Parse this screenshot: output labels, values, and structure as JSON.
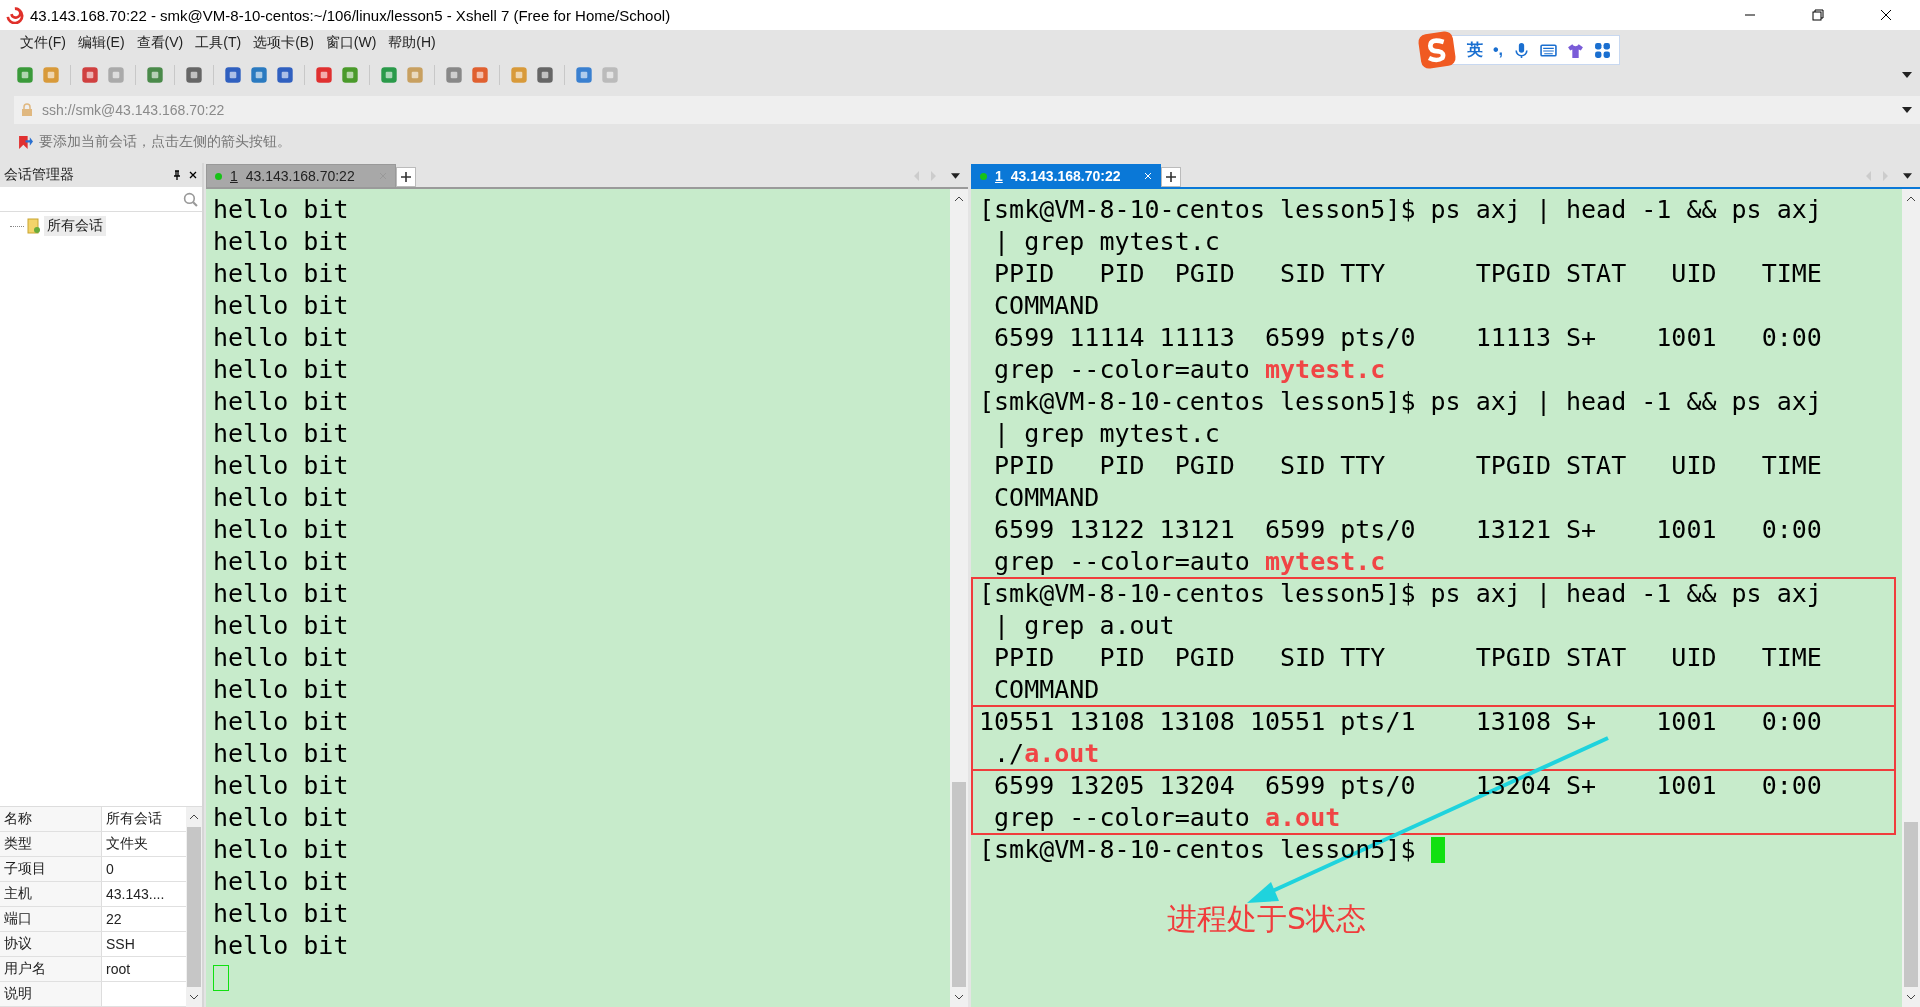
{
  "window": {
    "title": "43.143.168.70:22 - smk@VM-8-10-centos:~/106/linux/lesson5 - Xshell 7 (Free for Home/School)"
  },
  "menu": [
    "文件(F)",
    "编辑(E)",
    "查看(V)",
    "工具(T)",
    "选项卡(B)",
    "窗口(W)",
    "帮助(H)"
  ],
  "ime": {
    "mode": "英",
    "punctuation": "•,"
  },
  "address": {
    "value": "ssh://smk@43.143.168.70:22"
  },
  "hint": "要添加当前会话，点击左侧的箭头按钮。",
  "session_manager": {
    "title": "会话管理器",
    "tree": [
      {
        "label": "所有会话",
        "selected": true
      }
    ],
    "properties": [
      {
        "name": "名称",
        "value": "所有会话"
      },
      {
        "name": "类型",
        "value": "文件夹"
      },
      {
        "name": "子项目",
        "value": "0"
      },
      {
        "name": "主机",
        "value": "43.143...."
      },
      {
        "name": "端口",
        "value": "22"
      },
      {
        "name": "协议",
        "value": "SSH"
      },
      {
        "name": "用户名",
        "value": "root"
      },
      {
        "name": "说明"
      }
    ]
  },
  "panes": [
    {
      "tab": {
        "number": "1",
        "label": "43.143.168.70:22",
        "selected": false
      },
      "lines": [
        {
          "text": "hello bit"
        },
        {
          "text": "hello bit"
        },
        {
          "text": "hello bit"
        },
        {
          "text": "hello bit"
        },
        {
          "text": "hello bit"
        },
        {
          "text": "hello bit"
        },
        {
          "text": "hello bit"
        },
        {
          "text": "hello bit"
        },
        {
          "text": "hello bit"
        },
        {
          "text": "hello bit"
        },
        {
          "text": "hello bit"
        },
        {
          "text": "hello bit"
        },
        {
          "text": "hello bit"
        },
        {
          "text": "hello bit"
        },
        {
          "text": "hello bit"
        },
        {
          "text": "hello bit"
        },
        {
          "text": "hello bit"
        },
        {
          "text": "hello bit"
        },
        {
          "text": "hello bit"
        },
        {
          "text": "hello bit"
        },
        {
          "text": "hello bit"
        },
        {
          "text": "hello bit"
        },
        {
          "text": "hello bit"
        },
        {
          "text": "hello bit"
        },
        {
          "cursor": true
        }
      ]
    },
    {
      "tab": {
        "number": "1",
        "label": "43.143.168.70:22",
        "selected": true
      },
      "lines": [
        {
          "text": "[smk@VM-8-10-centos lesson5]$ ps axj | head -1 && ps axj"
        },
        {
          "text": " | grep mytest.c"
        },
        {
          "text": " PPID   PID  PGID   SID TTY      TPGID STAT   UID   TIME"
        },
        {
          "text": " COMMAND"
        },
        {
          "text": " 6599 11114 11113  6599 pts/0    11113 S+    1001   0:00"
        },
        {
          "text": " grep --color=auto ",
          "match": "mytest.c"
        },
        {
          "text": "[smk@VM-8-10-centos lesson5]$ ps axj | head -1 && ps axj"
        },
        {
          "text": " | grep mytest.c"
        },
        {
          "text": " PPID   PID  PGID   SID TTY      TPGID STAT   UID   TIME"
        },
        {
          "text": " COMMAND"
        },
        {
          "text": " 6599 13122 13121  6599 pts/0    13121 S+    1001   0:00"
        },
        {
          "text": " grep --color=auto ",
          "match": "mytest.c"
        },
        {
          "text": "[smk@VM-8-10-centos lesson5]$ ps axj | head -1 && ps axj"
        },
        {
          "text": " | grep a.out"
        },
        {
          "text": " PPID   PID  PGID   SID TTY      TPGID STAT   UID   TIME"
        },
        {
          "text": " COMMAND"
        },
        {
          "text": "10551 13108 13108 10551 pts/1    13108 S+    1001   0:00"
        },
        {
          "text": " ./",
          "match": "a.out"
        },
        {
          "text": " 6599 13205 13204  6599 pts/0    13204 S+    1001   0:00"
        },
        {
          "text": " grep --color=auto ",
          "match": "a.out"
        },
        {
          "text": "[smk@VM-8-10-centos lesson5]$ ",
          "cursor": true
        }
      ]
    }
  ],
  "annotation": {
    "label": "进程处于S状态"
  }
}
